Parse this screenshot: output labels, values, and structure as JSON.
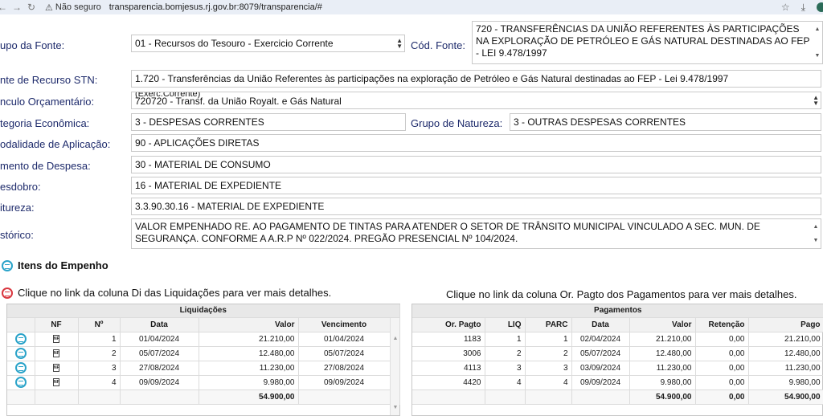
{
  "browser": {
    "security_label": "Não seguro",
    "url": "transparencia.bomjesus.rj.gov.br:8079/transparencia/#"
  },
  "form": {
    "tipo_fonte": {
      "label": "upo da Fonte:",
      "value": "01 - Recursos do Tesouro - Exercicio Corrente"
    },
    "cod_fonte": {
      "label": "Cód. Fonte:",
      "value": "720 - TRANSFERÊNCIAS DA UNIÃO REFERENTES ÀS PARTICIPAÇÕES NA EXPLORAÇÃO DE PETRÓLEO E GÁS NATURAL DESTINADAS AO FEP - LEI 9.478/1997"
    },
    "fonte_recurso_stn": {
      "label": "nte de Recurso STN:",
      "value": "1.720 - Transferências da União Referentes às participações na exploração de Petróleo e Gás Natural destinadas ao FEP - Lei 9.478/1997",
      "overlay": "(Exerc.Corrente)"
    },
    "vinculo": {
      "label": "nculo Orçamentário:",
      "value": "720720 - Transf. da União Royalt. e Gás Natural"
    },
    "categoria": {
      "label": "tegoria Econômica:",
      "value": "3 - DESPESAS CORRENTES"
    },
    "grupo_natureza": {
      "label": "Grupo de Natureza:",
      "value": "3 - OUTRAS DESPESAS CORRENTES"
    },
    "modalidade": {
      "label": "odalidade de Aplicação:",
      "value": "90 - APLICAÇÕES DIRETAS"
    },
    "elemento": {
      "label": "mento de Despesa:",
      "value": "30 - MATERIAL DE CONSUMO"
    },
    "desdobro": {
      "label": "esdobro:",
      "value": "16 - MATERIAL DE EXPEDIENTE"
    },
    "natureza": {
      "label": "itureza:",
      "value": "3.3.90.30.16 - MATERIAL DE EXPEDIENTE"
    },
    "historico": {
      "label": "stórico:",
      "value": "VALOR EMPENHADO RE. AO PAGAMENTO DE TINTAS PARA ATENDER O SETOR DE TRÂNSITO MUNICIPAL VINCULADO A SEC. MUN. DE SEGURANÇA. CONFORME A A.R.P Nº 022/2024. PREGÃO PRESENCIAL Nº 104/2024."
    }
  },
  "sections": {
    "itens": "Itens do Empenho",
    "hint_liq": "Clique no link da coluna Di das Liquidações para ver mais detalhes.",
    "hint_pag": "Clique no link da coluna Or. Pagto dos Pagamentos para ver mais detalhes."
  },
  "liquidacoes": {
    "caption": "Liquidações",
    "headers": [
      "NF",
      "Nº",
      "Data",
      "Valor",
      "Vencimento"
    ],
    "rows": [
      {
        "nf": "NF",
        "n": "1",
        "data": "01/04/2024",
        "valor": "21.210,00",
        "venc": "01/04/2024"
      },
      {
        "nf": "NF",
        "n": "2",
        "data": "05/07/2024",
        "valor": "12.480,00",
        "venc": "05/07/2024"
      },
      {
        "nf": "NF",
        "n": "3",
        "data": "27/08/2024",
        "valor": "11.230,00",
        "venc": "27/08/2024"
      },
      {
        "nf": "NF",
        "n": "4",
        "data": "09/09/2024",
        "valor": "9.980,00",
        "venc": "09/09/2024"
      }
    ],
    "total": "54.900,00"
  },
  "pagamentos": {
    "caption": "Pagamentos",
    "headers": [
      "Or. Pagto",
      "LIQ",
      "PARC",
      "Data",
      "Valor",
      "Retenção",
      "Pago"
    ],
    "rows": [
      {
        "or": "1183",
        "liq": "1",
        "parc": "1",
        "data": "02/04/2024",
        "valor": "21.210,00",
        "ret": "0,00",
        "pago": "21.210,00"
      },
      {
        "or": "3006",
        "liq": "2",
        "parc": "2",
        "data": "05/07/2024",
        "valor": "12.480,00",
        "ret": "0,00",
        "pago": "12.480,00"
      },
      {
        "or": "4113",
        "liq": "3",
        "parc": "3",
        "data": "03/09/2024",
        "valor": "11.230,00",
        "ret": "0,00",
        "pago": "11.230,00"
      },
      {
        "or": "4420",
        "liq": "4",
        "parc": "4",
        "data": "09/09/2024",
        "valor": "9.980,00",
        "ret": "0,00",
        "pago": "9.980,00"
      }
    ],
    "total": {
      "valor": "54.900,00",
      "ret": "0,00",
      "pago": "54.900,00"
    }
  }
}
